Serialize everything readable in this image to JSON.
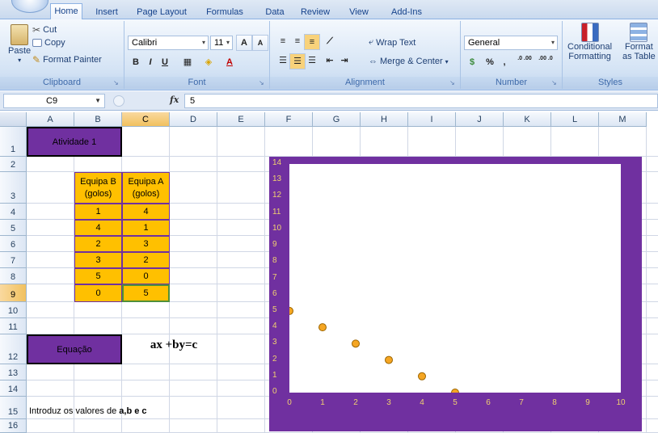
{
  "ribbon": {
    "tabs": [
      "Home",
      "Insert",
      "Page Layout",
      "Formulas",
      "Data",
      "Review",
      "View",
      "Add-Ins"
    ],
    "active_tab": "Home",
    "clipboard": {
      "label": "Clipboard",
      "paste": "Paste",
      "cut": "Cut",
      "copy": "Copy",
      "format_painter": "Format Painter"
    },
    "font": {
      "label": "Font",
      "name": "Calibri",
      "size": "11",
      "bold": "B",
      "italic": "I",
      "underline": "U"
    },
    "alignment": {
      "label": "Alignment",
      "wrap_text": "Wrap Text",
      "merge_center": "Merge & Center"
    },
    "number": {
      "label": "Number",
      "format": "General",
      "percent": "%",
      "comma": ",",
      "inc_decimal": ".0 .00",
      "dec_decimal": ".00 .0"
    },
    "styles": {
      "label": "Styles",
      "conditional_1": "Conditional",
      "conditional_2": "Formatting",
      "format_1": "Format",
      "format_2": "as Table"
    }
  },
  "formula_bar": {
    "name_box": "C9",
    "fx": "fx",
    "value": "5"
  },
  "columns": [
    "A",
    "B",
    "C",
    "D",
    "E",
    "F",
    "G",
    "H",
    "I",
    "J",
    "K",
    "L",
    "M"
  ],
  "rows": [
    "1",
    "2",
    "3",
    "4",
    "5",
    "6",
    "7",
    "8",
    "9",
    "10",
    "11",
    "12",
    "13",
    "14",
    "15",
    "16"
  ],
  "sheet": {
    "title": "Atividade 1",
    "header_b": [
      "Equipa B",
      "(golos)"
    ],
    "header_c": [
      "Equipa A",
      "(golos)"
    ],
    "table": [
      [
        "1",
        "4"
      ],
      [
        "4",
        "1"
      ],
      [
        "2",
        "3"
      ],
      [
        "3",
        "2"
      ],
      [
        "5",
        "0"
      ],
      [
        "0",
        "5"
      ]
    ],
    "equation_label": "Equação",
    "equation": "ax +by=c",
    "instruction_prefix": "Introduz os valores de ",
    "instruction_bold": "a,b e c"
  },
  "colors": {
    "purple": "#7030a0",
    "orange": "#ffc000",
    "tick_text": "#f0d070",
    "marker": "#f5a623"
  },
  "chart_data": {
    "type": "scatter",
    "title": "",
    "xlabel": "",
    "ylabel": "",
    "xlim": [
      0,
      10
    ],
    "ylim": [
      0,
      14
    ],
    "x_ticks": [
      0,
      1,
      2,
      3,
      4,
      5,
      6,
      7,
      8,
      9,
      10
    ],
    "y_ticks": [
      0,
      1,
      2,
      3,
      4,
      5,
      6,
      7,
      8,
      9,
      10,
      11,
      12,
      13,
      14
    ],
    "series": [
      {
        "x": [
          0,
          1,
          2,
          3,
          4,
          5
        ],
        "y": [
          5,
          4,
          3,
          2,
          1,
          0
        ]
      }
    ],
    "grid": false,
    "legend": "none"
  }
}
